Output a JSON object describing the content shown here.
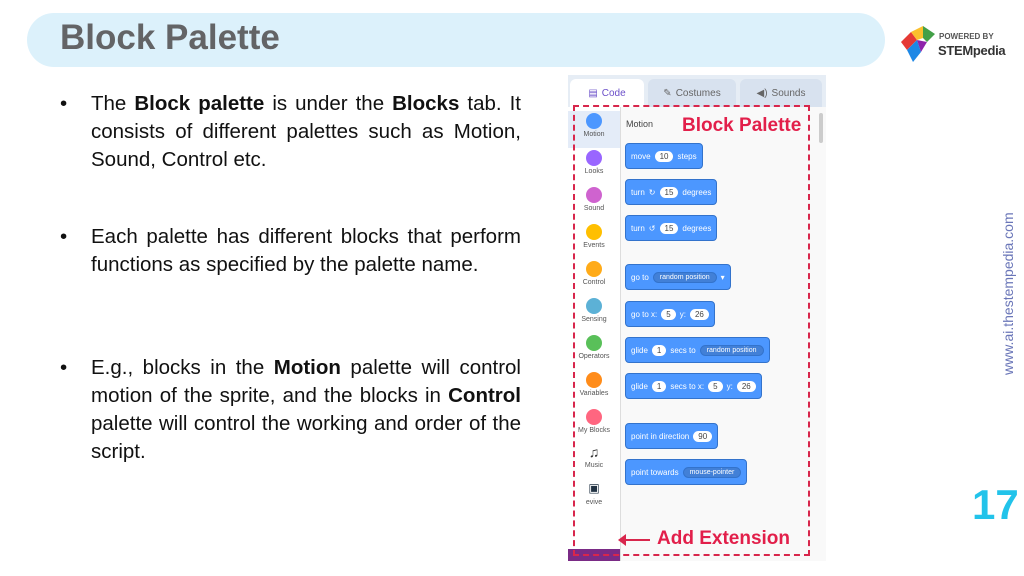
{
  "slide": {
    "title": "Block Palette",
    "page_number": "17",
    "side_url": "www.ai.thestempedia.com",
    "logo_powered": "POWERED BY",
    "logo_brand": "STEMpedia"
  },
  "bullets": {
    "b1": {
      "pre": "The ",
      "bold1": "Block palette",
      "mid": " is under the ",
      "bold2": "Blocks",
      "post": " tab. It consists of different palettes such as Motion, Sound, Control etc."
    },
    "b2": {
      "text": "Each palette has different blocks that perform functions as specified by the palette name."
    },
    "b3": {
      "pre": "E.g., blocks in the ",
      "bold1": "Motion",
      "mid": " palette will control motion of the sprite, and the blocks in ",
      "bold2": "Control",
      "post": " palette will control the working and order of the script."
    }
  },
  "screenshot": {
    "tabs": [
      "Code",
      "Costumes",
      "Sounds"
    ],
    "categories": [
      {
        "label": "Motion",
        "color": "#4c97ff"
      },
      {
        "label": "Looks",
        "color": "#9966ff"
      },
      {
        "label": "Sound",
        "color": "#cf63cf"
      },
      {
        "label": "Events",
        "color": "#ffbf00"
      },
      {
        "label": "Control",
        "color": "#ffab19"
      },
      {
        "label": "Sensing",
        "color": "#5cb1d6"
      },
      {
        "label": "Operators",
        "color": "#59c059"
      },
      {
        "label": "Variables",
        "color": "#ff8c1a"
      },
      {
        "label": "My Blocks",
        "color": "#ff6680"
      },
      {
        "label": "Music",
        "color": ""
      },
      {
        "label": "evive",
        "color": ""
      }
    ],
    "motion_header": "Motion",
    "blocks": {
      "move": {
        "a": "move",
        "v": "10",
        "b": "steps"
      },
      "turn_cw": {
        "a": "turn",
        "v": "15",
        "b": "degrees"
      },
      "turn_ccw": {
        "a": "turn",
        "v": "15",
        "b": "degrees"
      },
      "goto": {
        "a": "go to",
        "dd": "random position"
      },
      "gotoxy": {
        "a": "go to x:",
        "x": "5",
        "m": "y:",
        "y": "26"
      },
      "glide": {
        "a": "glide",
        "v": "1",
        "b": "secs to",
        "dd": "random position"
      },
      "glidexy": {
        "a": "glide",
        "v": "1",
        "b": "secs to x:",
        "x": "5",
        "m": "y:",
        "y": "26"
      },
      "point": {
        "a": "point in direction",
        "v": "90"
      },
      "towards": {
        "a": "point towards",
        "dd": "mouse-pointer"
      }
    },
    "label_palette": "Block Palette",
    "label_extension": "Add Extension"
  }
}
